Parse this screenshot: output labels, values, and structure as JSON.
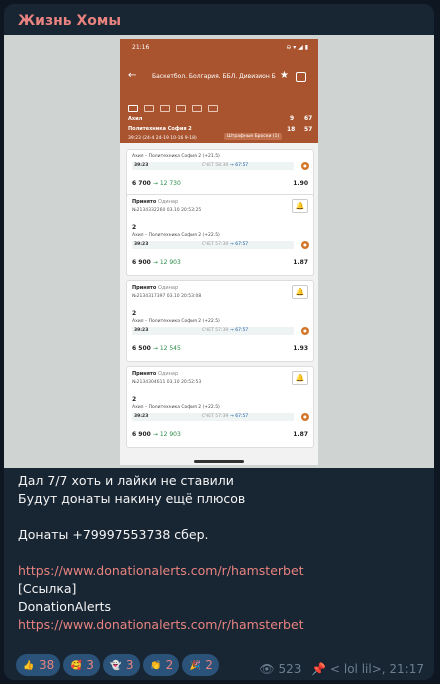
{
  "channel": {
    "name": "Жизнь Хомы"
  },
  "screenshot": {
    "status_time": "21:16",
    "status_icons": "⊖ ▾ ◢ ▮",
    "league": "Баскетбол. Болгария. ББЛ. Дивизион Б",
    "team1": "Ахил",
    "team2": "Политехника София 2",
    "team1_s1": "9",
    "team1_s2": "67",
    "team2_s1": "18",
    "team2_s2": "57",
    "periods": "39:23  (24-4 24-19 10-16 9-18)",
    "fines": "Штрафные Броски (1)",
    "cards": [
      {
        "account": "",
        "type": "",
        "number": "",
        "date": "",
        "pick": "",
        "event": "Ахил – Политехника София 2 (+21.5)",
        "time": "39:23",
        "score_label": "СЧЕТ",
        "score": "58:39",
        "live": "→ 67:57",
        "amount": "6 700",
        "win": "→ 12 730",
        "odds": "1.90"
      },
      {
        "account": "Принято",
        "type": "Одинар",
        "number": "№2134332260",
        "date": "03.10 20:53:25",
        "pick": "2",
        "event": "Ахил – Политехника София 2 (+22.5)",
        "time": "39:23",
        "score_label": "СЧЕТ",
        "score": "57:39",
        "live": "→ 67:57",
        "amount": "6 900",
        "win": "→ 12 903",
        "odds": "1.87"
      },
      {
        "account": "Принято",
        "type": "Одинар",
        "number": "№2134317397",
        "date": "03.10 20:53:08",
        "pick": "2",
        "event": "Ахил – Политехника София 2 (+22.5)",
        "time": "39:23",
        "score_label": "СЧЕТ",
        "score": "57:39",
        "live": "→ 67:57",
        "amount": "6 500",
        "win": "→ 12 545",
        "odds": "1.93"
      },
      {
        "account": "Принято",
        "type": "Одинар",
        "number": "№2134304611",
        "date": "03.10 20:52:53",
        "pick": "2",
        "event": "Ахил – Политехника София 2 (+22.5)",
        "time": "39:23",
        "score_label": "СЧЕТ",
        "score": "57:39",
        "live": "→ 67:57",
        "amount": "6 900",
        "win": "→ 12 903",
        "odds": "1.87"
      }
    ]
  },
  "message": {
    "lines": [
      "Дал 7/7 хоть и лайки не ставили",
      "Будут донаты накину ещё плюсов",
      "",
      "Донаты +79997553738 сбер.",
      ""
    ],
    "link1": "https://www.donationalerts.com/r/hamsterbet",
    "preview_label": "[Ссылка]",
    "preview_site": "DonationAlerts",
    "link2": "https://www.donationalerts.com/r/hamsterbet"
  },
  "reactions": [
    {
      "emoji": "👍",
      "icon": "thumbs-up",
      "count": "38",
      "color": "#f3b93a"
    },
    {
      "emoji": "🥰",
      "icon": "smiling-face-hearts",
      "count": "3",
      "color": "#f3b93a"
    },
    {
      "emoji": "👻",
      "icon": "ghost",
      "count": "3",
      "color": "#e8e8e8"
    },
    {
      "emoji": "👏",
      "icon": "clapping-hands",
      "count": "2",
      "color": "#f3b93a"
    },
    {
      "emoji": "🎉",
      "icon": "party-popper",
      "count": "2",
      "color": "#e07a3f"
    }
  ],
  "meta": {
    "views": "523",
    "author": "< lol lil>",
    "time": "21:17"
  },
  "colors": {
    "accent": "#e8837f",
    "bubble": "#182533",
    "reaction_bg": "#2b5278"
  }
}
